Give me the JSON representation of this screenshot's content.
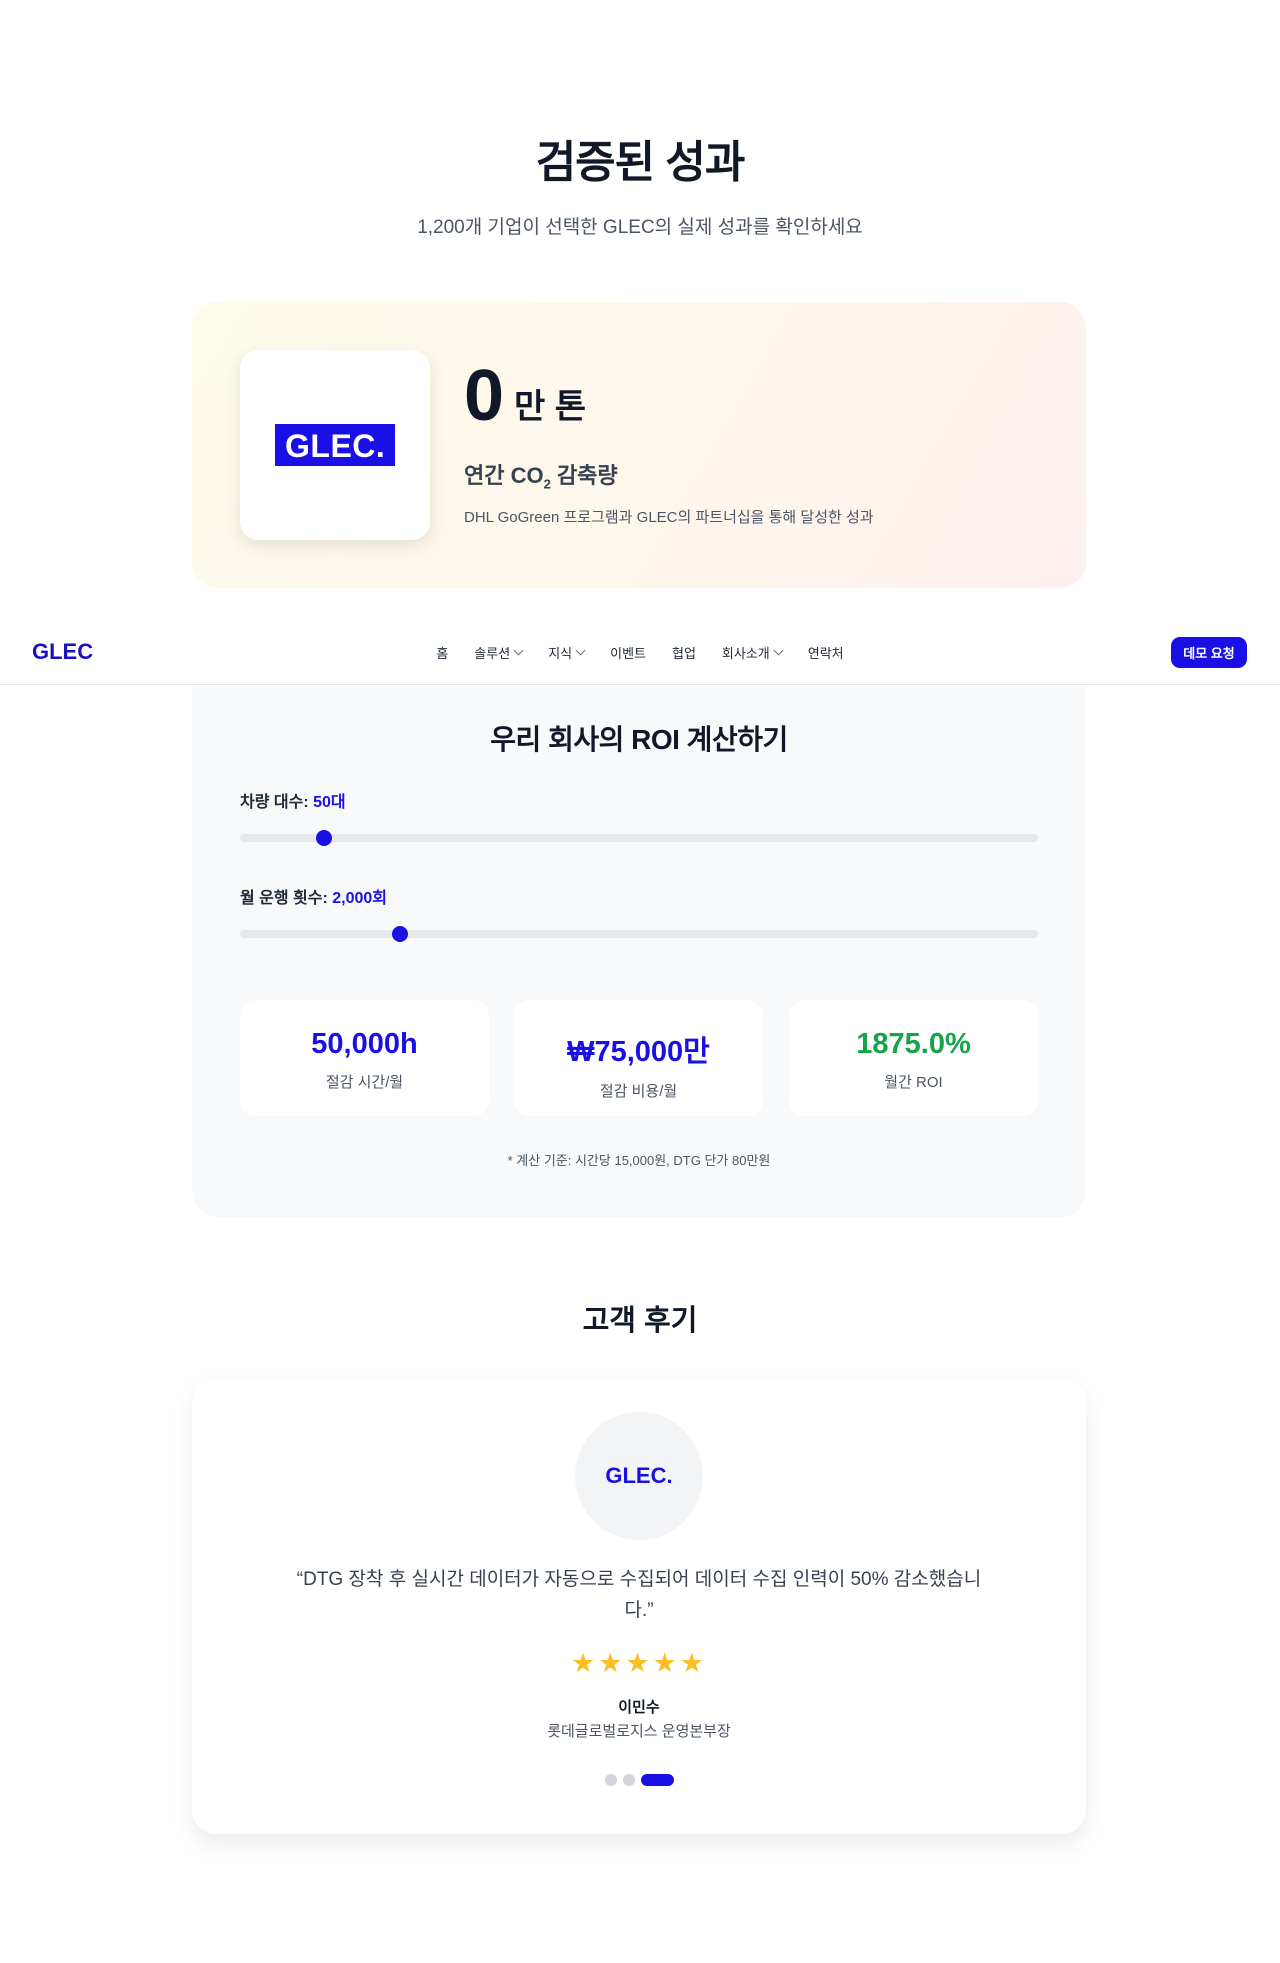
{
  "performance": {
    "title": "검증된 성과",
    "subtitle": "1,200개 기업이 선택한 GLEC의 실제 성과를 확인하세요",
    "case": {
      "logo_text": "GLEC.",
      "value": "0",
      "unit": "만 톤",
      "label_prefix": "연간 CO",
      "label_sub": "2",
      "label_suffix": " 감축량",
      "description": "DHL GoGreen 프로그램과 GLEC의 파트너십을 통해 달성한 성과"
    }
  },
  "navbar": {
    "brand": "GLEC",
    "items": [
      {
        "label": "홈",
        "has_dropdown": false
      },
      {
        "label": "솔루션",
        "has_dropdown": true
      },
      {
        "label": "지식",
        "has_dropdown": true
      },
      {
        "label": "이벤트",
        "has_dropdown": false
      },
      {
        "label": "협업",
        "has_dropdown": false
      },
      {
        "label": "회사소개",
        "has_dropdown": true
      },
      {
        "label": "연락처",
        "has_dropdown": false
      }
    ],
    "cta": "데모 요청",
    "accent_color": "#1a10e6"
  },
  "roi": {
    "title": "우리 회사의 ROI 계산하기",
    "vehicles": {
      "label": "차량 대수: ",
      "value": "50대",
      "fraction": 0.105
    },
    "trips": {
      "label": "월 운행 횟수: ",
      "value": "2,000회",
      "fraction": 0.2
    },
    "results": [
      {
        "value": "50,000h",
        "label": "절감 시간/월",
        "color": "#1a10e6"
      },
      {
        "value": "₩75,000만",
        "label": "절감 비용/월",
        "color": "#1a10e6"
      },
      {
        "value": "1875.0%",
        "label": "월간 ROI",
        "color": "#16a34a"
      }
    ],
    "note": "* 계산 기준: 시간당 15,000원, DTG 단가 80만원"
  },
  "reviews": {
    "title": "고객 후기",
    "avatar_text": "GLEC.",
    "quote": "“DTG 장착 후 실시간 데이터가 자동으로 수집되어 데이터 수집 인력이 50% 감소했습니다.”",
    "stars": "★★★★★",
    "rating": 5,
    "name": "이민수",
    "role": "롯데글로벌로지스 운영본부장",
    "active_index": 2
  }
}
